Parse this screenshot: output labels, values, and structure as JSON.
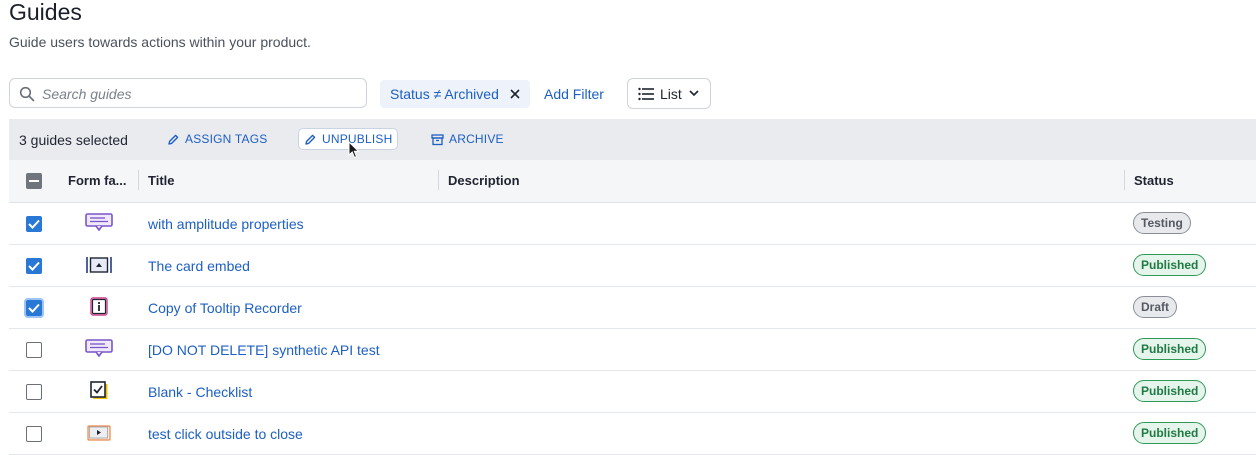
{
  "header": {
    "title": "Guides",
    "subtitle": "Guide users towards actions within your product."
  },
  "toolbar": {
    "search_placeholder": "Search guides",
    "filter_label": "Status ≠ Archived",
    "add_filter_label": "Add Filter",
    "view_label": "List"
  },
  "bulk_actions": {
    "selected_count": "3 guides selected",
    "assign_tags": "ASSIGN TAGS",
    "unpublish": "UNPUBLISH",
    "archive": "ARCHIVE"
  },
  "table": {
    "columns": [
      "Form fa...",
      "Title",
      "Description",
      "Status"
    ],
    "rows": [
      {
        "checked": true,
        "form_factor_icon": "banner-speech-icon",
        "title": "with amplitude properties",
        "description": "",
        "status": "Testing"
      },
      {
        "checked": true,
        "form_factor_icon": "card-embed-icon",
        "title": "The card embed",
        "description": "",
        "status": "Published"
      },
      {
        "checked": true,
        "form_factor_icon": "tooltip-info-icon",
        "title": "Copy of Tooltip Recorder",
        "description": "",
        "status": "Draft"
      },
      {
        "checked": false,
        "form_factor_icon": "banner-speech-icon",
        "title": "[DO NOT DELETE] synthetic API test",
        "description": "",
        "status": "Published"
      },
      {
        "checked": false,
        "form_factor_icon": "checklist-icon",
        "title": "Blank - Checklist",
        "description": "",
        "status": "Published"
      },
      {
        "checked": false,
        "form_factor_icon": "video-modal-icon",
        "title": "test click outside to close",
        "description": "",
        "status": "Published"
      }
    ]
  },
  "colors": {
    "link": "#1d5fc2",
    "checkbox_checked": "#2a78d6",
    "published": "#2f9a58",
    "bulk_bar": "#e9ebef"
  }
}
